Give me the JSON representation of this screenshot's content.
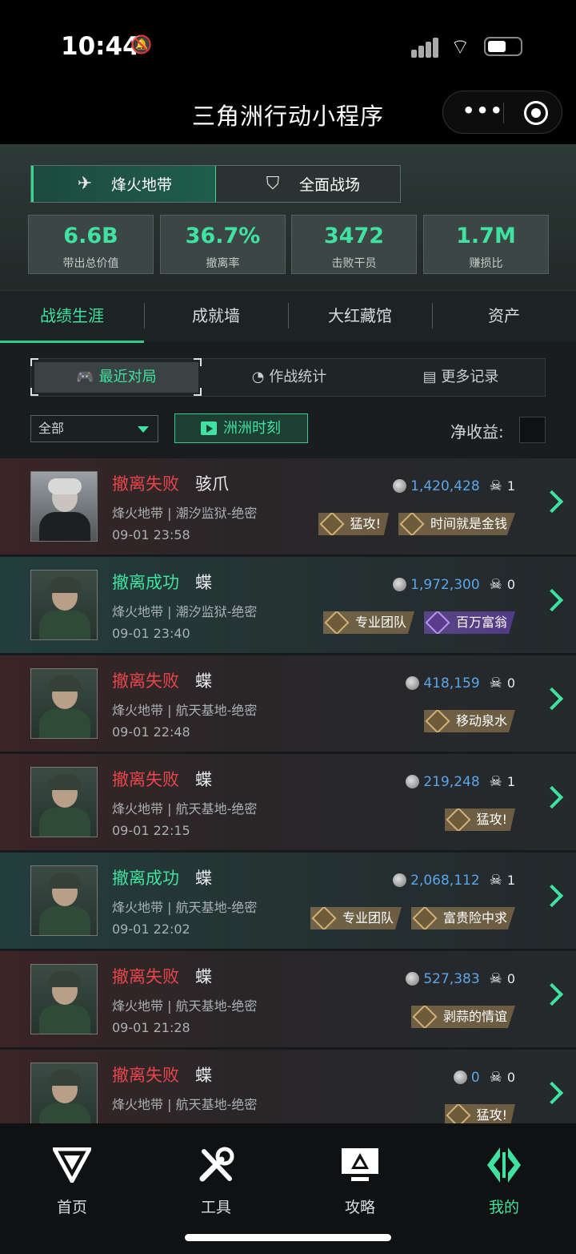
{
  "status_bar": {
    "time": "10:44"
  },
  "nav_bar": {
    "title": "三角洲行动小程序"
  },
  "modes": [
    {
      "label": "烽火地带",
      "active": true
    },
    {
      "label": "全面战场",
      "active": false
    }
  ],
  "stats": [
    {
      "value": "6.6B",
      "label": "带出总价值"
    },
    {
      "value": "36.7%",
      "label": "撤离率"
    },
    {
      "value": "3472",
      "label": "击败干员"
    },
    {
      "value": "1.7M",
      "label": "赚损比"
    }
  ],
  "tabs": [
    "战绩生涯",
    "成就墙",
    "大红藏馆",
    "资产"
  ],
  "subtabs": [
    "最近对局",
    "作战统计",
    "更多记录"
  ],
  "filter": {
    "value": "全部"
  },
  "moments_button": "洲洲时刻",
  "net_income_label": "净收益:",
  "matches": [
    {
      "result": "撤离失败",
      "status": "fail",
      "hero": "骇爪",
      "place": "烽火地带 | 潮汐监狱-绝密",
      "time": "09-01 23:58",
      "value": "1,420,428",
      "kills": "1",
      "badges": [
        "猛攻!",
        "时间就是金钱"
      ],
      "badge_styles": [
        "gold",
        "gold"
      ]
    },
    {
      "result": "撤离成功",
      "status": "ok",
      "hero": "蝶",
      "place": "烽火地带 | 潮汐监狱-绝密",
      "time": "09-01 23:40",
      "value": "1,972,300",
      "kills": "0",
      "badges": [
        "专业团队",
        "百万富翁"
      ],
      "badge_styles": [
        "gold",
        "purple"
      ]
    },
    {
      "result": "撤离失败",
      "status": "fail",
      "hero": "蝶",
      "place": "烽火地带 | 航天基地-绝密",
      "time": "09-01 22:48",
      "value": "418,159",
      "kills": "0",
      "badges": [
        "移动泉水"
      ],
      "badge_styles": [
        "gold"
      ]
    },
    {
      "result": "撤离失败",
      "status": "fail",
      "hero": "蝶",
      "place": "烽火地带 | 航天基地-绝密",
      "time": "09-01 22:15",
      "value": "219,248",
      "kills": "1",
      "badges": [
        "猛攻!"
      ],
      "badge_styles": [
        "gold"
      ]
    },
    {
      "result": "撤离成功",
      "status": "ok",
      "hero": "蝶",
      "place": "烽火地带 | 航天基地-绝密",
      "time": "09-01 22:02",
      "value": "2,068,112",
      "kills": "1",
      "badges": [
        "专业团队",
        "富贵险中求"
      ],
      "badge_styles": [
        "gold",
        "gold"
      ]
    },
    {
      "result": "撤离失败",
      "status": "fail",
      "hero": "蝶",
      "place": "烽火地带 | 航天基地-绝密",
      "time": "09-01 21:28",
      "value": "527,383",
      "kills": "0",
      "badges": [
        "剥蒜的情谊"
      ],
      "badge_styles": [
        "gold"
      ]
    },
    {
      "result": "撤离失败",
      "status": "fail",
      "hero": "蝶",
      "place": "烽火地带 | 航天基地-绝密",
      "time": "",
      "value": "0",
      "kills": "0",
      "badges": [
        "猛攻!"
      ],
      "badge_styles": [
        "gold"
      ]
    }
  ],
  "bottom_nav": [
    {
      "label": "首页",
      "icon": "home-logo-icon",
      "active": false
    },
    {
      "label": "工具",
      "icon": "tools-icon",
      "active": false
    },
    {
      "label": "攻略",
      "icon": "guide-monitor-icon",
      "active": false
    },
    {
      "label": "我的",
      "icon": "profile-logo-icon",
      "active": true
    }
  ],
  "colors": {
    "accent": "#3fe2a0",
    "fail": "#e8464a",
    "value": "#5ba6e8"
  }
}
